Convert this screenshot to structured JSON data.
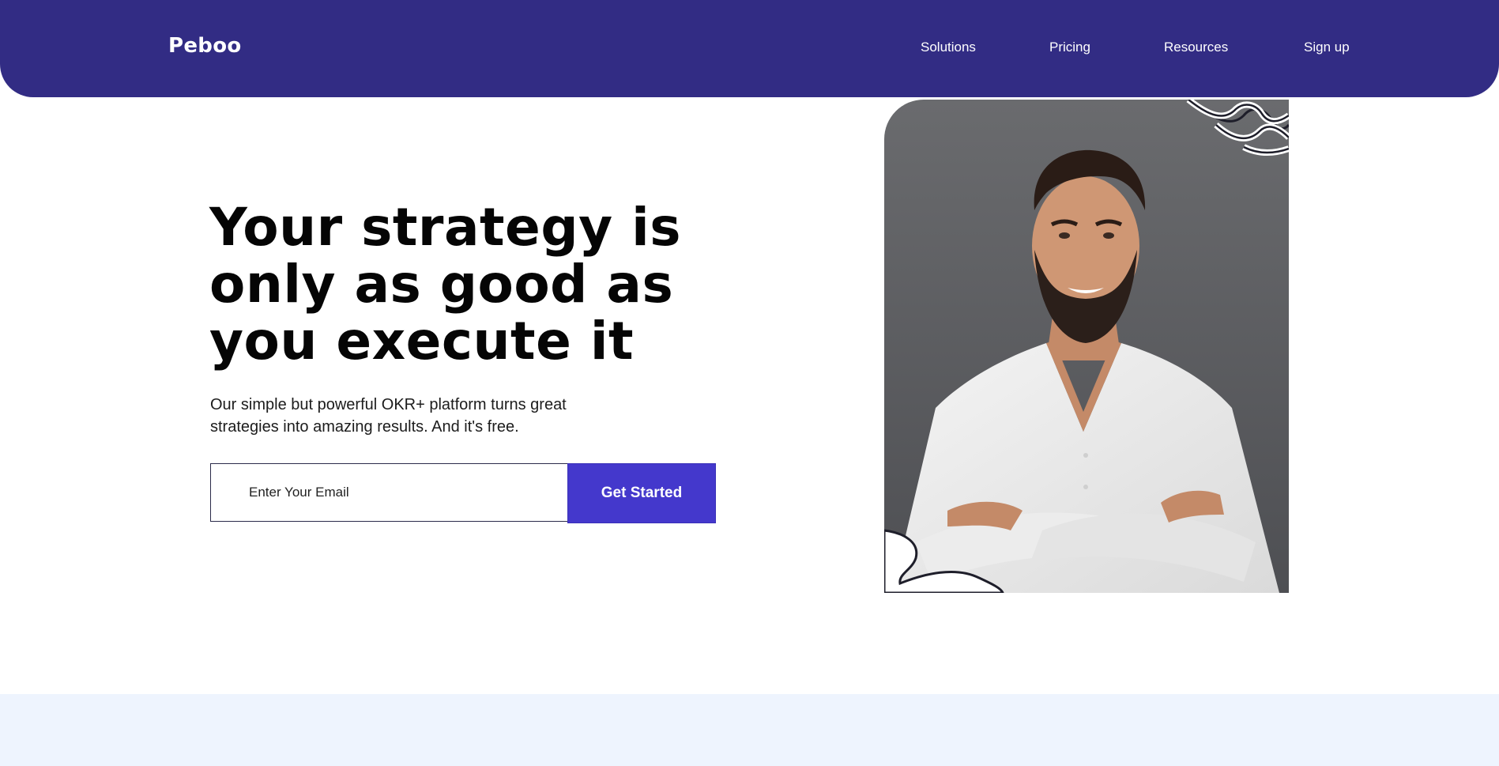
{
  "header": {
    "logo": "Peboo",
    "nav": [
      {
        "label": "Solutions"
      },
      {
        "label": "Pricing"
      },
      {
        "label": "Resources"
      },
      {
        "label": "Sign up"
      }
    ]
  },
  "hero": {
    "headline": "Your strategy is only as good as you execute it",
    "subtext": "Our simple but powerful OKR+ platform turns great strategies into amazing results. And it's free.",
    "email_placeholder": "Enter Your Email",
    "cta_label": "Get Started"
  },
  "colors": {
    "header_bg": "#322c84",
    "cta_bg": "#4438cc",
    "bottom_band": "#eef4fe"
  },
  "icons": [
    "person-photo",
    "squiggle-decoration",
    "blob-decoration"
  ]
}
